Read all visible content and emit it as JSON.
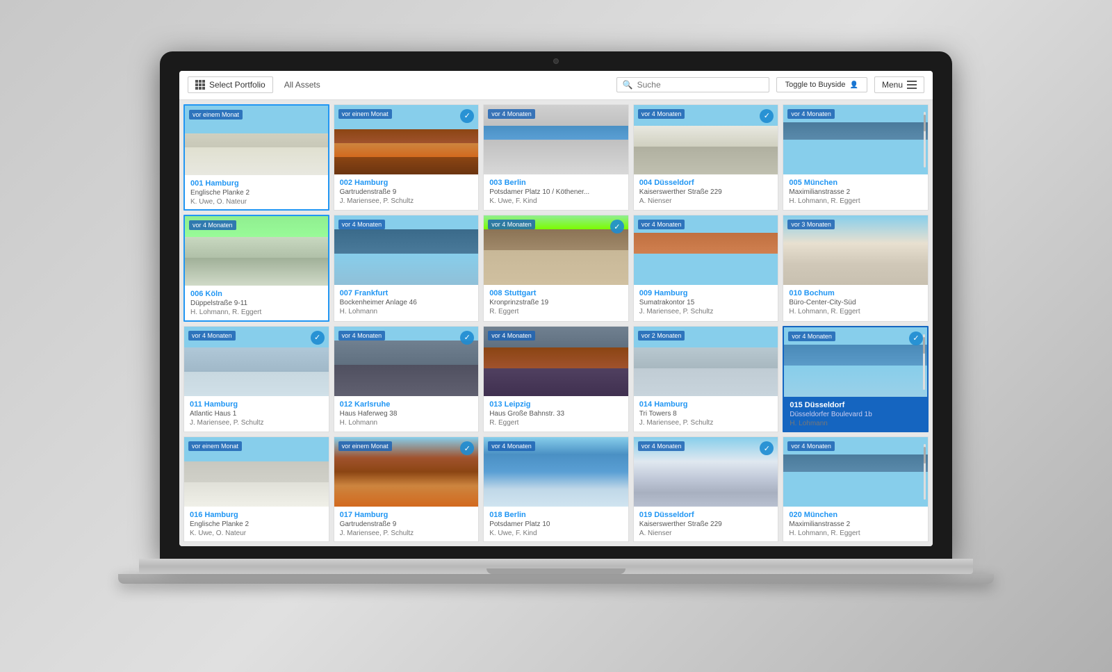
{
  "toolbar": {
    "portfolio_label": "Select Portfolio",
    "all_assets_label": "All Assets",
    "search_placeholder": "Suche",
    "toggle_buyside_label": "Toggle to Buyside",
    "menu_label": "Menu"
  },
  "properties": [
    {
      "id": "001",
      "city": "Hamburg",
      "title": "001 Hamburg",
      "address": "Englische Planke 2",
      "agents": "K. Uwe, O. Nateur",
      "timestamp": "vor einem Monat",
      "building_class": "building-1",
      "selected": true,
      "check": false,
      "scroll": false
    },
    {
      "id": "002",
      "city": "Hamburg",
      "title": "002 Hamburg",
      "address": "Gartrudenstraße 9",
      "agents": "J. Mariensee, P. Schultz",
      "timestamp": "vor einem Monat",
      "building_class": "building-2",
      "selected": false,
      "check": true,
      "scroll": false
    },
    {
      "id": "003",
      "city": "Berlin",
      "title": "003 Berlin",
      "address": "Potsdamer Platz 10 / Köthener...",
      "agents": "K. Uwe, F. Kind",
      "timestamp": "vor 4 Monaten",
      "building_class": "building-3",
      "selected": false,
      "check": false,
      "scroll": false
    },
    {
      "id": "004",
      "city": "Düsseldorf",
      "title": "004 Düsseldorf",
      "address": "Kaiserswerther Straße 229",
      "agents": "A. Nienser",
      "timestamp": "vor 4 Monaten",
      "building_class": "building-4",
      "selected": false,
      "check": true,
      "scroll": false
    },
    {
      "id": "005",
      "city": "München",
      "title": "005 München",
      "address": "Maximilianstrasse 2",
      "agents": "H. Lohmann, R. Eggert",
      "timestamp": "vor 4 Monaten",
      "building_class": "building-5",
      "selected": false,
      "check": false,
      "scroll": true
    },
    {
      "id": "006",
      "city": "Köln",
      "title": "006 Köln",
      "address": "Düppelstraße 9-11",
      "agents": "H. Lohmann, R. Eggert",
      "timestamp": "vor 4 Monaten",
      "building_class": "building-6",
      "selected": true,
      "check": false,
      "scroll": false
    },
    {
      "id": "007",
      "city": "Frankfurt",
      "title": "007 Frankfurt",
      "address": "Bockenheimer Anlage 46",
      "agents": "H. Lohmann",
      "timestamp": "vor 4 Monaten",
      "building_class": "building-7",
      "selected": false,
      "check": false,
      "scroll": false
    },
    {
      "id": "008",
      "city": "Stuttgart",
      "title": "008 Stuttgart",
      "address": "Kronprinzstraße 19",
      "agents": "R. Eggert",
      "timestamp": "vor 4 Monaten",
      "building_class": "building-8",
      "selected": false,
      "check": true,
      "scroll": false
    },
    {
      "id": "009",
      "city": "Hamburg",
      "title": "009 Hamburg",
      "address": "Sumatrakontor 15",
      "agents": "J. Mariensee, P. Schultz",
      "timestamp": "vor 4 Monaten",
      "building_class": "building-9",
      "selected": false,
      "check": false,
      "scroll": false
    },
    {
      "id": "010",
      "city": "Bochum",
      "title": "010 Bochum",
      "address": "Büro-Center-City-Süd",
      "agents": "H. Lohmann, R. Eggert",
      "timestamp": "vor 3 Monaten",
      "building_class": "building-10",
      "selected": false,
      "check": false,
      "scroll": false
    },
    {
      "id": "011",
      "city": "Hamburg",
      "title": "011 Hamburg",
      "address": "Atlantic Haus 1",
      "agents": "J. Mariensee, P. Schultz",
      "timestamp": "vor 4 Monaten",
      "building_class": "building-11",
      "selected": false,
      "check": true,
      "scroll": false
    },
    {
      "id": "012",
      "city": "Karlsruhe",
      "title": "012 Karlsruhe",
      "address": "Haus Haferweg 38",
      "agents": "H. Lohmann",
      "timestamp": "vor 4 Monaten",
      "building_class": "building-12",
      "selected": false,
      "check": true,
      "scroll": false
    },
    {
      "id": "013",
      "city": "Leipzig",
      "title": "013 Leipzig",
      "address": "Haus Große Bahnstr. 33",
      "agents": "R. Eggert",
      "timestamp": "vor 4 Monaten",
      "building_class": "building-13",
      "selected": false,
      "check": false,
      "scroll": false
    },
    {
      "id": "014",
      "city": "Hamburg",
      "title": "014 Hamburg",
      "address": "Tri Towers 8",
      "agents": "J. Mariensee, P. Schultz",
      "timestamp": "vor 2 Monaten",
      "building_class": "building-14",
      "selected": false,
      "check": false,
      "scroll": false
    },
    {
      "id": "015",
      "city": "Düsseldorf",
      "title": "015 Düsseldorf",
      "address": "Düsseldorfer Boulevard 1b",
      "agents": "H. Lohmann",
      "timestamp": "vor 4 Monaten",
      "building_class": "building-15",
      "selected": true,
      "dark_selected": true,
      "check": true,
      "scroll": true
    },
    {
      "id": "016",
      "city": "Hamburg",
      "title": "016 Hamburg",
      "address": "Englische Planke 2",
      "agents": "K. Uwe, O. Nateur",
      "timestamp": "vor einem Monat",
      "building_class": "building-r1",
      "selected": false,
      "check": false,
      "scroll": false
    },
    {
      "id": "017",
      "city": "Hamburg",
      "title": "017 Hamburg",
      "address": "Gartrudenstraße 9",
      "agents": "J. Mariensee, P. Schultz",
      "timestamp": "vor einem Monat",
      "building_class": "building-r2",
      "selected": false,
      "check": true,
      "scroll": false
    },
    {
      "id": "018",
      "city": "Berlin",
      "title": "018 Berlin",
      "address": "Potsdamer Platz 10",
      "agents": "K. Uwe, F. Kind",
      "timestamp": "vor 4 Monaten",
      "building_class": "building-r3",
      "selected": false,
      "check": false,
      "scroll": false
    },
    {
      "id": "019",
      "city": "Düsseldorf",
      "title": "019 Düsseldorf",
      "address": "Kaiserswerther Straße 229",
      "agents": "A. Nienser",
      "timestamp": "vor 4 Monaten",
      "building_class": "building-r4",
      "selected": false,
      "check": true,
      "scroll": false
    },
    {
      "id": "020",
      "city": "München",
      "title": "020 München",
      "address": "Maximilianstrasse 2",
      "agents": "H. Lohmann, R. Eggert",
      "timestamp": "vor 4 Monaten",
      "building_class": "building-r5",
      "selected": false,
      "check": false,
      "scroll": true
    }
  ]
}
